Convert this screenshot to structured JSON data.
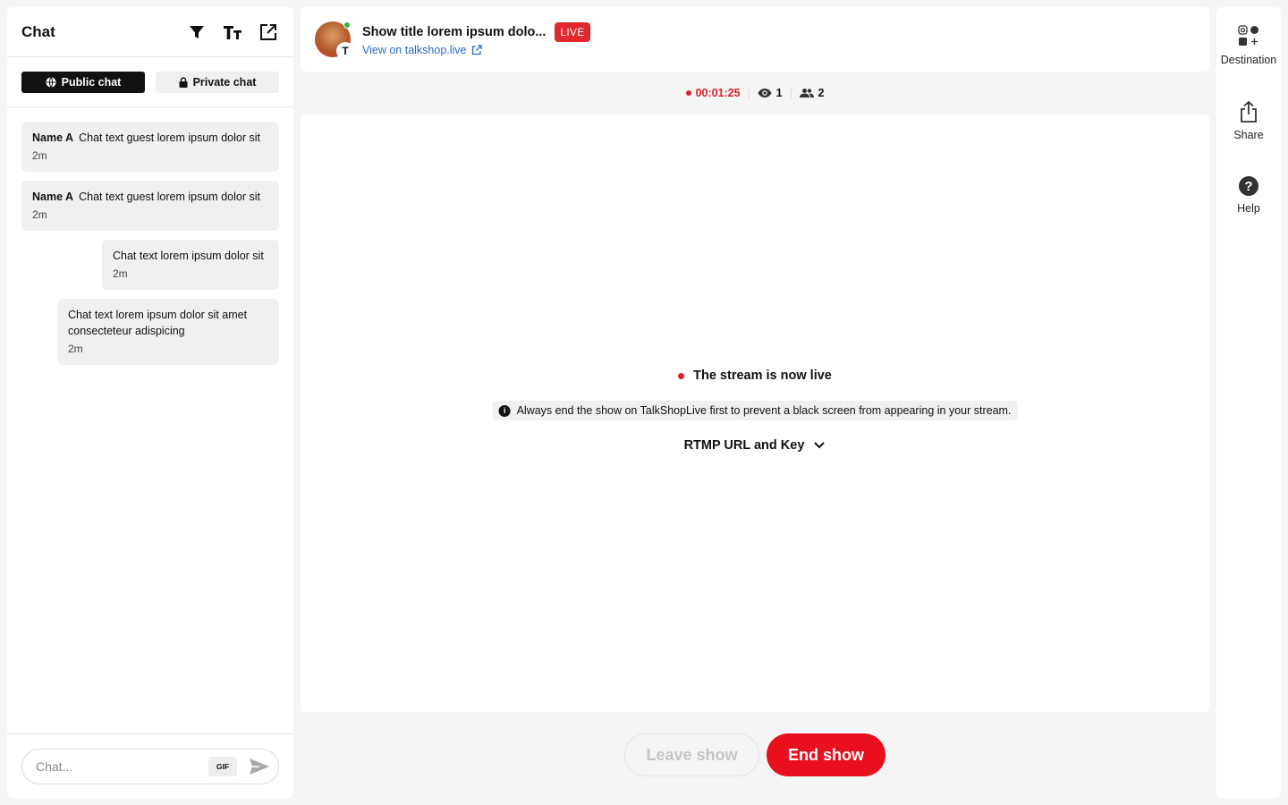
{
  "chat": {
    "title": "Chat",
    "tabs": {
      "public": "Public chat",
      "private": "Private chat"
    },
    "messages": [
      {
        "name": "Name A",
        "text": "Chat text guest lorem ipsum dolor sit",
        "time": "2m"
      },
      {
        "name": "Name A",
        "text": "Chat text guest lorem ipsum dolor sit",
        "time": "2m"
      },
      {
        "text": "Chat text lorem ipsum dolor sit",
        "time": "2m"
      },
      {
        "text": "Chat text lorem ipsum dolor sit amet consecteteur adispicing",
        "time": "2m"
      }
    ],
    "input_placeholder": "Chat...",
    "gif_label": "GIF"
  },
  "show": {
    "title": "Show title lorem ipsum dolo...",
    "live_badge": "LIVE",
    "view_link": "View on talkshop.live",
    "avatar_brand": "T"
  },
  "stats": {
    "timer": "00:01:25",
    "viewers": "1",
    "participants": "2"
  },
  "stream": {
    "status": "The stream is now live",
    "notice": "Always end the show on TalkShopLive first to prevent a black screen from appearing in your stream.",
    "info_glyph": "i",
    "rtmp_label": "RTMP URL and Key"
  },
  "actions": {
    "leave": "Leave show",
    "end": "End show"
  },
  "rail": {
    "destination": "Destination",
    "share": "Share",
    "help": "Help",
    "help_glyph": "?"
  },
  "colors": {
    "accent_red": "#e8101f",
    "live_red": "#e0282e",
    "link_blue": "#2a69c6"
  }
}
